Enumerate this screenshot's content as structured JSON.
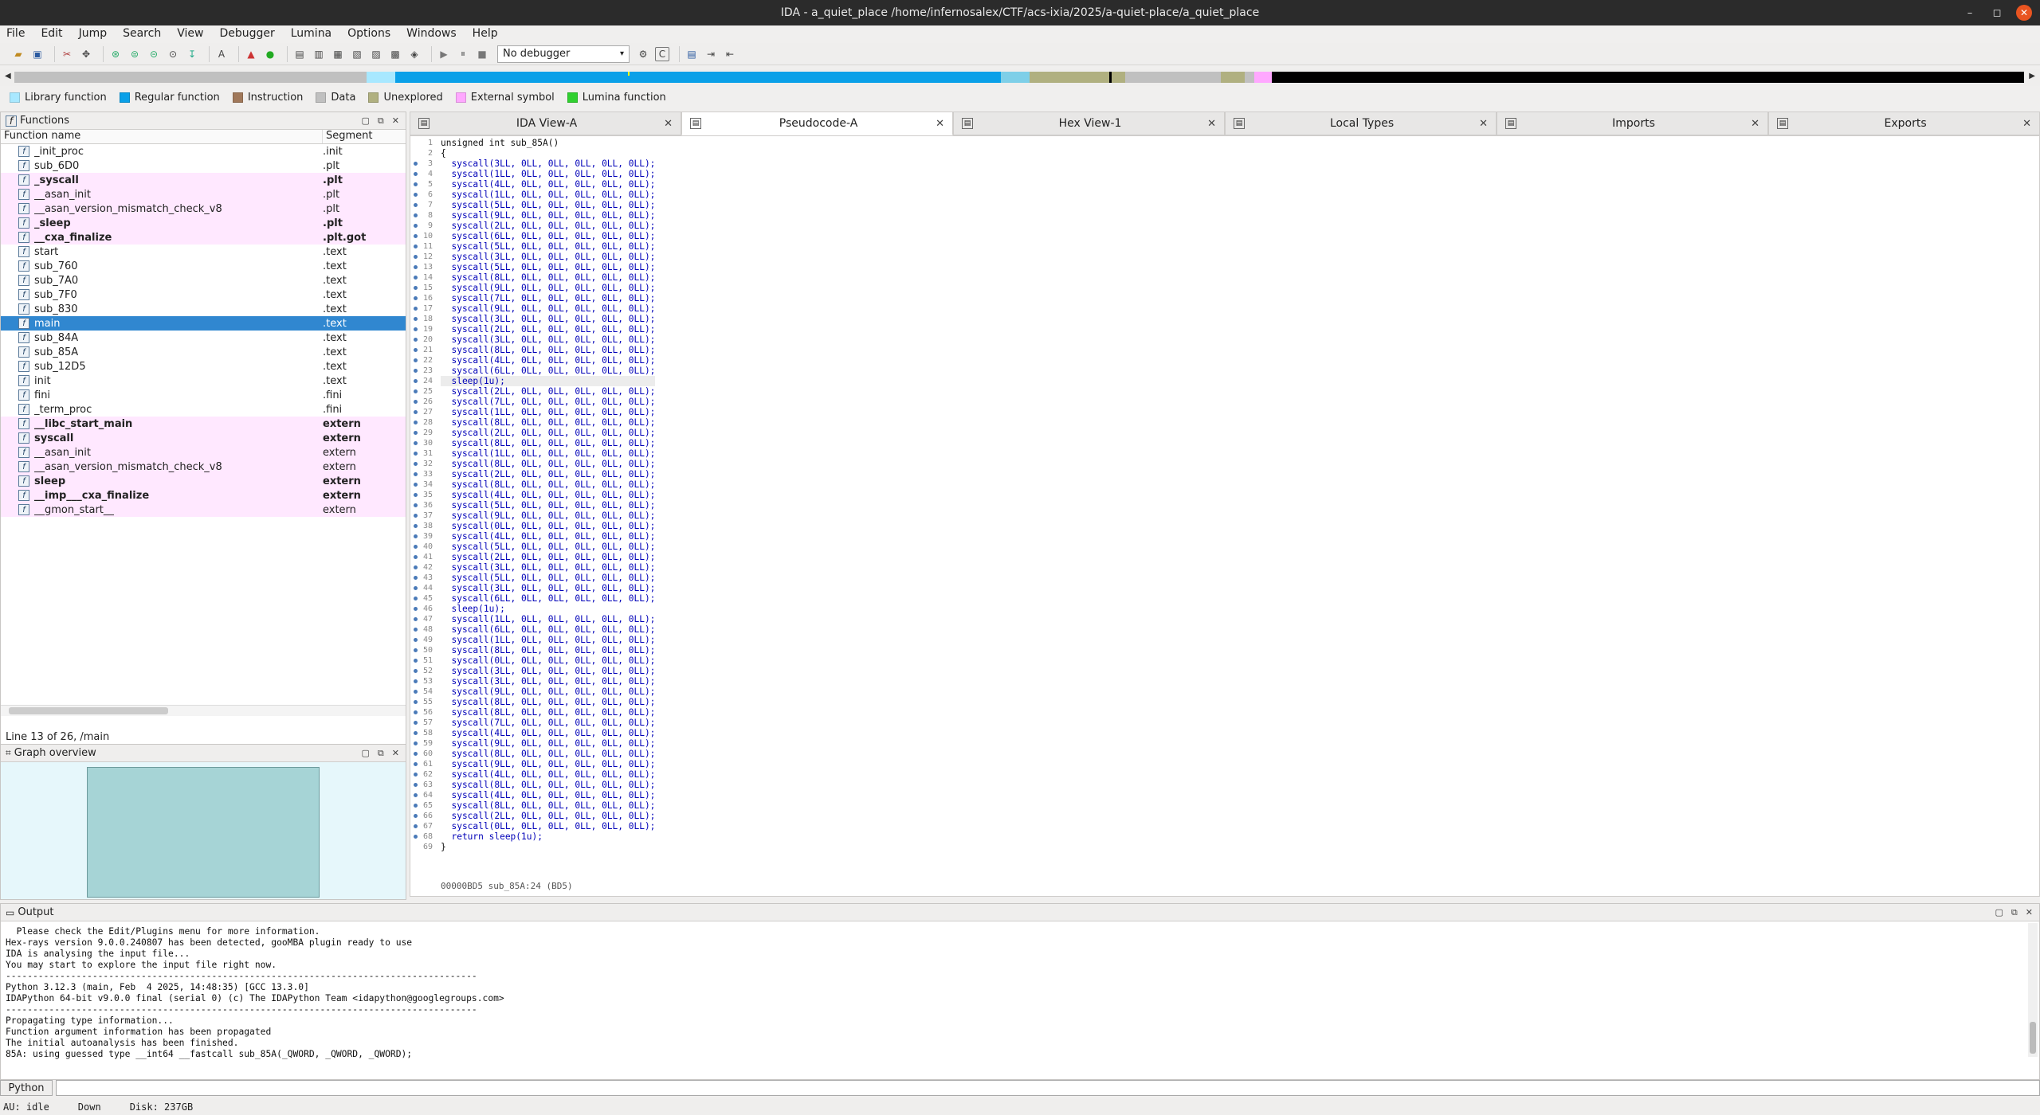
{
  "window": {
    "title": "IDA - a_quiet_place /home/infernosalex/CTF/acs-ixia/2025/a-quiet-place/a_quiet_place"
  },
  "menu": [
    "File",
    "Edit",
    "Jump",
    "Search",
    "View",
    "Debugger",
    "Lumina",
    "Options",
    "Windows",
    "Help"
  ],
  "toolbar": {
    "debugger_select": "No debugger"
  },
  "legend": [
    {
      "label": "Library function",
      "color": "#a8e8ff"
    },
    {
      "label": "Regular function",
      "color": "#0aa0e8"
    },
    {
      "label": "Instruction",
      "color": "#a0785a"
    },
    {
      "label": "Data",
      "color": "#c0c0c0"
    },
    {
      "label": "Unexplored",
      "color": "#b0b080"
    },
    {
      "label": "External symbol",
      "color": "#ffa8ff"
    },
    {
      "label": "Lumina function",
      "color": "#30d030"
    }
  ],
  "functions_panel": {
    "title": "Functions",
    "col_name": "Function name",
    "col_segment": "Segment",
    "rows": [
      {
        "name": "_init_proc",
        "seg": ".init",
        "style": ""
      },
      {
        "name": "sub_6D0",
        "seg": ".plt",
        "style": ""
      },
      {
        "name": "_syscall",
        "seg": ".plt",
        "style": "pink bold"
      },
      {
        "name": "__asan_init",
        "seg": ".plt",
        "style": "pink"
      },
      {
        "name": "__asan_version_mismatch_check_v8",
        "seg": ".plt",
        "style": "pink"
      },
      {
        "name": "_sleep",
        "seg": ".plt",
        "style": "pink bold"
      },
      {
        "name": "__cxa_finalize",
        "seg": ".plt.got",
        "style": "pink bold"
      },
      {
        "name": "start",
        "seg": ".text",
        "style": ""
      },
      {
        "name": "sub_760",
        "seg": ".text",
        "style": ""
      },
      {
        "name": "sub_7A0",
        "seg": ".text",
        "style": ""
      },
      {
        "name": "sub_7F0",
        "seg": ".text",
        "style": ""
      },
      {
        "name": "sub_830",
        "seg": ".text",
        "style": ""
      },
      {
        "name": "main",
        "seg": ".text",
        "style": "sel"
      },
      {
        "name": "sub_84A",
        "seg": ".text",
        "style": ""
      },
      {
        "name": "sub_85A",
        "seg": ".text",
        "style": ""
      },
      {
        "name": "sub_12D5",
        "seg": ".text",
        "style": ""
      },
      {
        "name": "init",
        "seg": ".text",
        "style": ""
      },
      {
        "name": "fini",
        "seg": ".fini",
        "style": ""
      },
      {
        "name": "_term_proc",
        "seg": ".fini",
        "style": ""
      },
      {
        "name": "__libc_start_main",
        "seg": "extern",
        "style": "pink bold"
      },
      {
        "name": "syscall",
        "seg": "extern",
        "style": "pink bold"
      },
      {
        "name": "__asan_init",
        "seg": "extern",
        "style": "pink"
      },
      {
        "name": "__asan_version_mismatch_check_v8",
        "seg": "extern",
        "style": "pink"
      },
      {
        "name": "sleep",
        "seg": "extern",
        "style": "pink bold"
      },
      {
        "name": "__imp___cxa_finalize",
        "seg": "extern",
        "style": "pink bold"
      },
      {
        "name": "__gmon_start__",
        "seg": "extern",
        "style": "pink"
      }
    ],
    "status": "Line 13 of 26, /main"
  },
  "graph_panel": {
    "title": "Graph overview"
  },
  "tabs": [
    {
      "label": "IDA View-A",
      "active": false
    },
    {
      "label": "Pseudocode-A",
      "active": true
    },
    {
      "label": "Hex View-1",
      "active": false
    },
    {
      "label": "Local Types",
      "active": false
    },
    {
      "label": "Imports",
      "active": false
    },
    {
      "label": "Exports",
      "active": false
    }
  ],
  "pseudocode": {
    "header": "unsigned int sub_85A()",
    "syscall_args": [
      3,
      1,
      4,
      1,
      5,
      9,
      2,
      6,
      5,
      3,
      5,
      8,
      9,
      7,
      9,
      3,
      2,
      3,
      8,
      4,
      6,
      null,
      2,
      7,
      1,
      8,
      2,
      8,
      1,
      8,
      2,
      8,
      4,
      5,
      9,
      0,
      4,
      5,
      2,
      3,
      5,
      3,
      6,
      null,
      1,
      6,
      1,
      8,
      0,
      3,
      3,
      9,
      8,
      8,
      7,
      4,
      9,
      8,
      9,
      4,
      8,
      4,
      8,
      2,
      0
    ],
    "sleep_text": "sleep(1u);",
    "return_text": "return sleep(1u);",
    "highlight_line": 24,
    "status": "00000BD5 sub_85A:24 (BD5)"
  },
  "output_panel": {
    "title": "Output",
    "lines": [
      "  Please check the Edit/Plugins menu for more information.",
      "Hex-rays version 9.0.0.240807 has been detected, gooMBA plugin ready to use",
      "IDA is analysing the input file...",
      "You may start to explore the input file right now.",
      "---------------------------------------------------------------------------------------",
      "Python 3.12.3 (main, Feb  4 2025, 14:48:35) [GCC 13.3.0]",
      "IDAPython 64-bit v9.0.0 final (serial 0) (c) The IDAPython Team <idapython@googlegroups.com>",
      "---------------------------------------------------------------------------------------",
      "Propagating type information...",
      "Function argument information has been propagated",
      "The initial autoanalysis has been finished.",
      "85A: using guessed type __int64 __fastcall sub_85A(_QWORD, _QWORD, _QWORD);"
    ],
    "input_label": "Python"
  },
  "statusbar": {
    "au": "AU:  idle",
    "dir": "Down",
    "disk": "Disk: 237GB"
  }
}
